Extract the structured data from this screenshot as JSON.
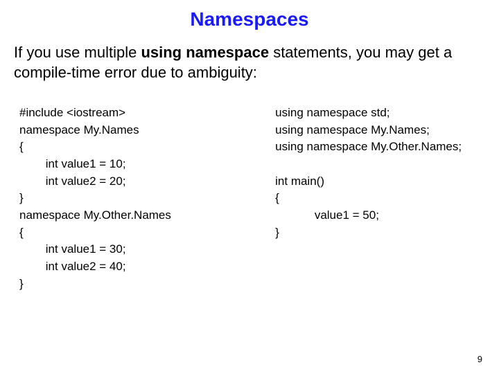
{
  "title": "Namespaces",
  "intro_pre": "If you use multiple ",
  "intro_kw": "using namespace",
  "intro_post": " statements, you may get a compile-time error due to ambiguity:",
  "code_left": "#include <iostream>\nnamespace My.Names\n{\n        int value1 = 10;\n        int value2 = 20;\n}\nnamespace My.Other.Names\n{\n        int value1 = 30;\n        int value2 = 40;\n}",
  "code_right": "using namespace std;\nusing namespace My.Names;\nusing namespace My.Other.Names;\n\nint main()\n{\n            value1 = 50;\n}",
  "page_number": "9"
}
